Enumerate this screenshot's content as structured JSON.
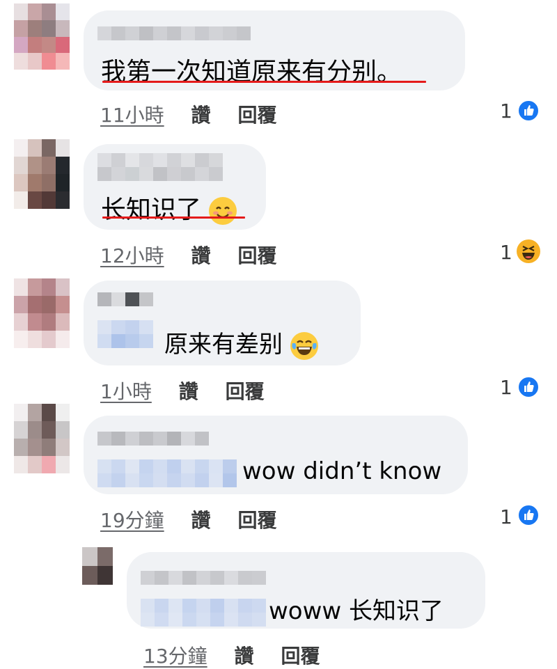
{
  "comments": [
    {
      "text": "我第一次知道原来有分别",
      "punct": "。",
      "time": "11小時",
      "like_label": "讚",
      "reply_label": "回覆",
      "reaction_count": "1",
      "reaction": "like-icon"
    },
    {
      "text": "长知识了",
      "time": "12小時",
      "like_label": "讚",
      "reply_label": "回覆",
      "reaction_count": "1",
      "reaction": "haha-icon"
    },
    {
      "text": "原来有差别",
      "time": "1小時",
      "like_label": "讚",
      "reply_label": "回覆",
      "reaction_count": "1",
      "reaction": "like-icon"
    },
    {
      "text": "wow didn’t know",
      "time": "19分鐘",
      "like_label": "讚",
      "reply_label": "回覆",
      "reaction_count": "1",
      "reaction": "like-icon"
    },
    {
      "text": "woww 长知识了",
      "time": "13分鐘",
      "like_label": "讚",
      "reply_label": "回覆"
    }
  ],
  "colors": {
    "underline": "#e41a1a",
    "like": "#1877f2",
    "bubble": "#f0f2f5",
    "meta": "#65676b"
  }
}
